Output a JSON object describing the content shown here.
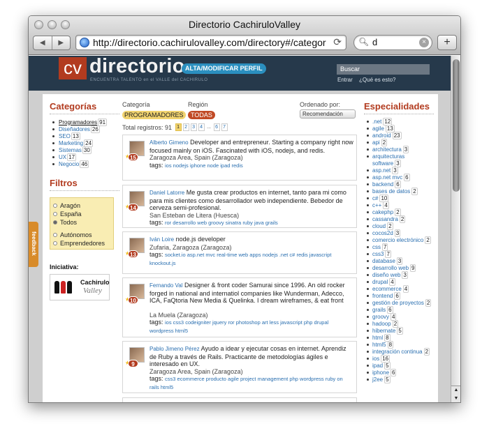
{
  "window": {
    "title": "Directorio CachiruloValley"
  },
  "toolbar": {
    "url": "http://directorio.cachirulovalley.com/directory#/categoria/",
    "search_value": "d",
    "back_icon": "◀",
    "forward_icon": "▶",
    "reload_icon": "⟳",
    "add_icon": "+"
  },
  "header": {
    "logo_cv": "cv",
    "logo_text": "directorio",
    "logo_sub": "ENCUENTRA TALENTO en el VALLE del CACHIRULO",
    "alta_button": "ALTA/MODIFICAR PERFIL",
    "search_placeholder": "Buscar",
    "link_enter": "Entrar",
    "link_about": "¿Qué es esto?"
  },
  "categorias": {
    "title": "Categorías",
    "items": [
      {
        "label": "Programadores",
        "count": "91"
      },
      {
        "label": "Diseñadores",
        "count": "26"
      },
      {
        "label": "SEO",
        "count": "13"
      },
      {
        "label": "Marketing",
        "count": "24"
      },
      {
        "label": "Sistemas",
        "count": "30"
      },
      {
        "label": "UX",
        "count": "17"
      },
      {
        "label": "Negocio",
        "count": "46"
      }
    ]
  },
  "filtros": {
    "title": "Filtros",
    "options_region": [
      "Aragón",
      "España",
      "Todos"
    ],
    "options_type": [
      "Autónomos",
      "Emprendedores"
    ]
  },
  "iniciativa": {
    "label": "Iniciativa:",
    "logo_text_1": "Cachirulo",
    "logo_text_2": "Valley"
  },
  "feedback": {
    "label": "feedback"
  },
  "filters_bar": {
    "categoria_label": "Categoría",
    "categoria_value": "PROGRAMADORES",
    "region_label": "Región",
    "region_value": "TODAS",
    "orden_label": "Ordenado por:",
    "orden_value": "Recomendación",
    "total_label": "Total registros:",
    "total": "91",
    "pages": [
      "1",
      "2",
      "3",
      "4",
      "...",
      "6",
      "7"
    ]
  },
  "profiles": [
    {
      "name": "Alberto Gimeno",
      "bio": "Developer and entrepreneur. Starting a company right now focused mainly on iOS. Fascinated with iOS, nodejs, and redis.",
      "location": "Zaragoza Area, Spain (Zaragoza)",
      "tags": "ios nodejs iphone node ipad redis",
      "score": "15"
    },
    {
      "name": "Daniel Latorre",
      "bio": "Me gusta crear productos en internet, tanto para mi como para mis clientes como desarrollador web independiente. Bebedor de cerveza semi-profesional.",
      "location": "San Esteban de Litera (Huesca)",
      "tags": "ror desarrollo web groovy sinatra ruby java grails",
      "score": "14"
    },
    {
      "name": "Iván Loire",
      "bio": "node.js developer",
      "location": "Zufaria, Zaragoza (Zaragoza)",
      "tags": "socket.io asp.net mvc real-time web apps nodejs .net c# redis javascript knockout.js",
      "score": "13"
    },
    {
      "name": "Fernando Val",
      "bio": "Designer & front coder Samurai since 1996. An old rocker forged in national and internatiol companies like Wunderman, Adecco, ICA, FaQtoria New Media & Quelinka. I dream wireframes, & eat front",
      "location": "La Muela (Zaragoza)",
      "tags": "ios css3 codeigniter jquery ror photoshop art less javascript php drupal wordpress html5",
      "score": "10"
    },
    {
      "name": "Pablo Jimeno Pérez",
      "bio": "Ayudo a idear y ejecutar cosas en internet. Aprendiz de Ruby a través de Rails. Practicante de metodologías ágiles e interesado en UX.",
      "location": "Zaragoza Area, Spain (Zaragoza)",
      "tags": "css3 ecommerce producto agile project management php wordpress ruby on rails html5",
      "score": "9"
    }
  ],
  "especialidades": {
    "title": "Especialidades",
    "items": [
      {
        "label": ".net",
        "count": "12"
      },
      {
        "label": "agile",
        "count": "13"
      },
      {
        "label": "android",
        "count": "23"
      },
      {
        "label": "api",
        "count": "2"
      },
      {
        "label": "architectura",
        "count": "3"
      },
      {
        "label": "arquitecturas software",
        "count": "3"
      },
      {
        "label": "asp.net",
        "count": "3"
      },
      {
        "label": "asp.net mvc",
        "count": "6"
      },
      {
        "label": "backend",
        "count": "6"
      },
      {
        "label": "bases de datos",
        "count": "2"
      },
      {
        "label": "c#",
        "count": "10"
      },
      {
        "label": "c++",
        "count": "4"
      },
      {
        "label": "cakephp",
        "count": "2"
      },
      {
        "label": "cassandra",
        "count": "2"
      },
      {
        "label": "cloud",
        "count": "2"
      },
      {
        "label": "cocos2d",
        "count": "3"
      },
      {
        "label": "comercio electrónico",
        "count": "2"
      },
      {
        "label": "css",
        "count": "7"
      },
      {
        "label": "css3",
        "count": "7"
      },
      {
        "label": "database",
        "count": "3"
      },
      {
        "label": "desarrollo web",
        "count": "9"
      },
      {
        "label": "diseño web",
        "count": "3"
      },
      {
        "label": "drupal",
        "count": "4"
      },
      {
        "label": "ecommerce",
        "count": "4"
      },
      {
        "label": "frontend",
        "count": "6"
      },
      {
        "label": "gestión de proyectos",
        "count": "2"
      },
      {
        "label": "grails",
        "count": "6"
      },
      {
        "label": "groovy",
        "count": "4"
      },
      {
        "label": "hadoop",
        "count": "2"
      },
      {
        "label": "hibernate",
        "count": "5"
      },
      {
        "label": "html",
        "count": "8"
      },
      {
        "label": "html5",
        "count": "8"
      },
      {
        "label": "integración continua",
        "count": "2"
      },
      {
        "label": "ios",
        "count": "16"
      },
      {
        "label": "ipad",
        "count": "5"
      },
      {
        "label": "iphone",
        "count": "6"
      },
      {
        "label": "j2ee",
        "count": "5"
      }
    ]
  }
}
